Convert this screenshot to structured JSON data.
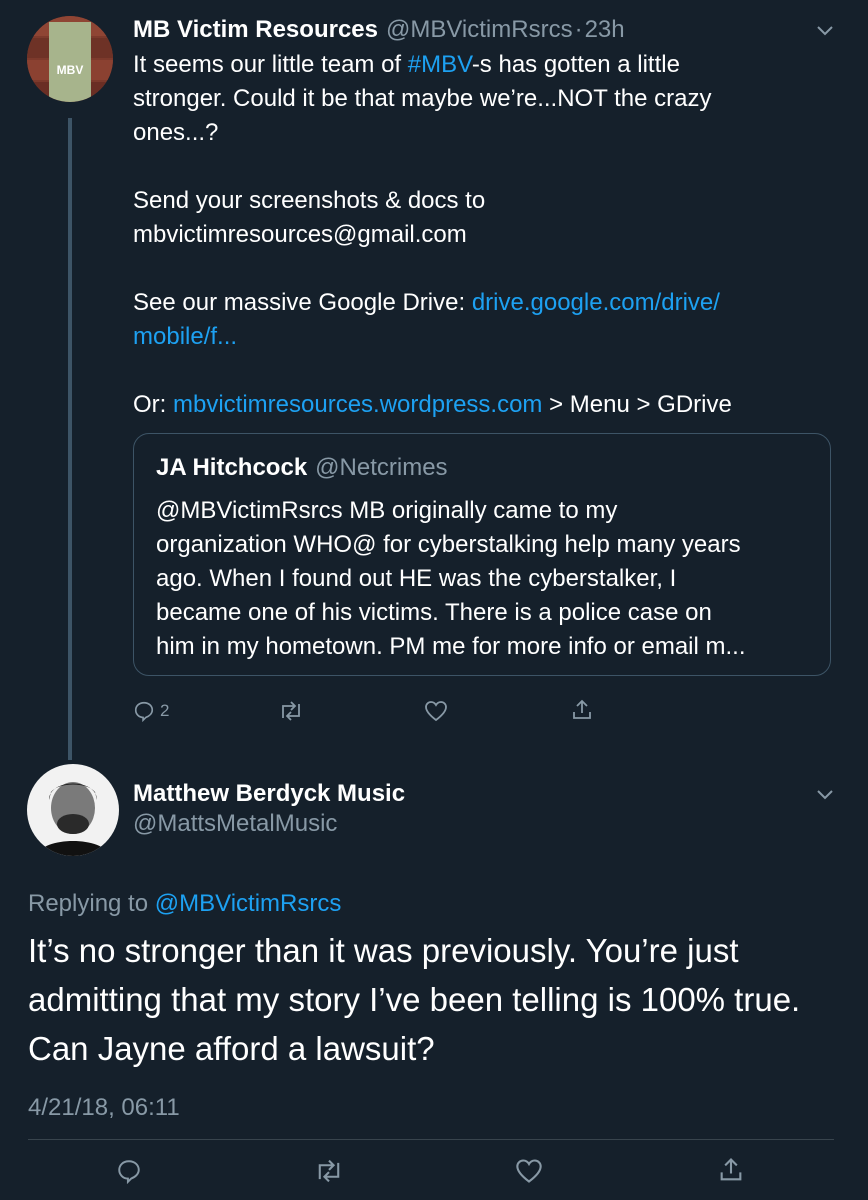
{
  "tweet1": {
    "name": "MB Victim Resources",
    "handle": "@MBVictimRsrcs",
    "sep": "·",
    "time": "23h",
    "avatar_logo": "MBV",
    "l1a": "It seems our little team of ",
    "l1b": "#MBV",
    "l1c": "-s has gotten a little",
    "l2": "stronger. Could it be that maybe we’re...NOT the crazy",
    "l3": "ones...?",
    "l4": "Send your screenshots & docs to",
    "l5": "mbvictimresources@gmail.com",
    "l6a": "See our massive Google Drive: ",
    "l6b": "drive.google.com/drive/",
    "l7": "mobile/f...",
    "l8a": "Or: ",
    "l8b": "mbvictimresources.wordpress.com",
    "l8c": " > Menu > GDrive",
    "reply_count": "2"
  },
  "quote": {
    "name": "JA Hitchcock",
    "handle": "@Netcrimes",
    "lines": [
      "@MBVictimRsrcs MB originally came to my",
      "organization WHO@ for cyberstalking help many years",
      "ago. When I found out HE was the cyberstalker, I",
      "became one of his victims. There is a police case on",
      "him in my hometown. PM me for  more info or email m..."
    ]
  },
  "tweet2": {
    "name": "Matthew Berdyck Music",
    "handle": "@MattsMetalMusic",
    "replying_prefix": "Replying to ",
    "replying_handle": "@MBVictimRsrcs",
    "lines": [
      "It’s no stronger than it was previously. You’re just",
      "admitting that my story I’ve been telling is 100% true.",
      "Can Jayne afford a lawsuit?"
    ],
    "timestamp": "4/21/18, 06:11"
  },
  "icons": {
    "reply": "reply-icon",
    "retweet": "retweet-icon",
    "like": "heart-icon",
    "share": "share-icon",
    "chevron": "chevron-down-icon"
  },
  "colors": {
    "background": "#15202b",
    "link": "#1da1f2",
    "secondary": "#8899a6",
    "border": "#38444d"
  }
}
